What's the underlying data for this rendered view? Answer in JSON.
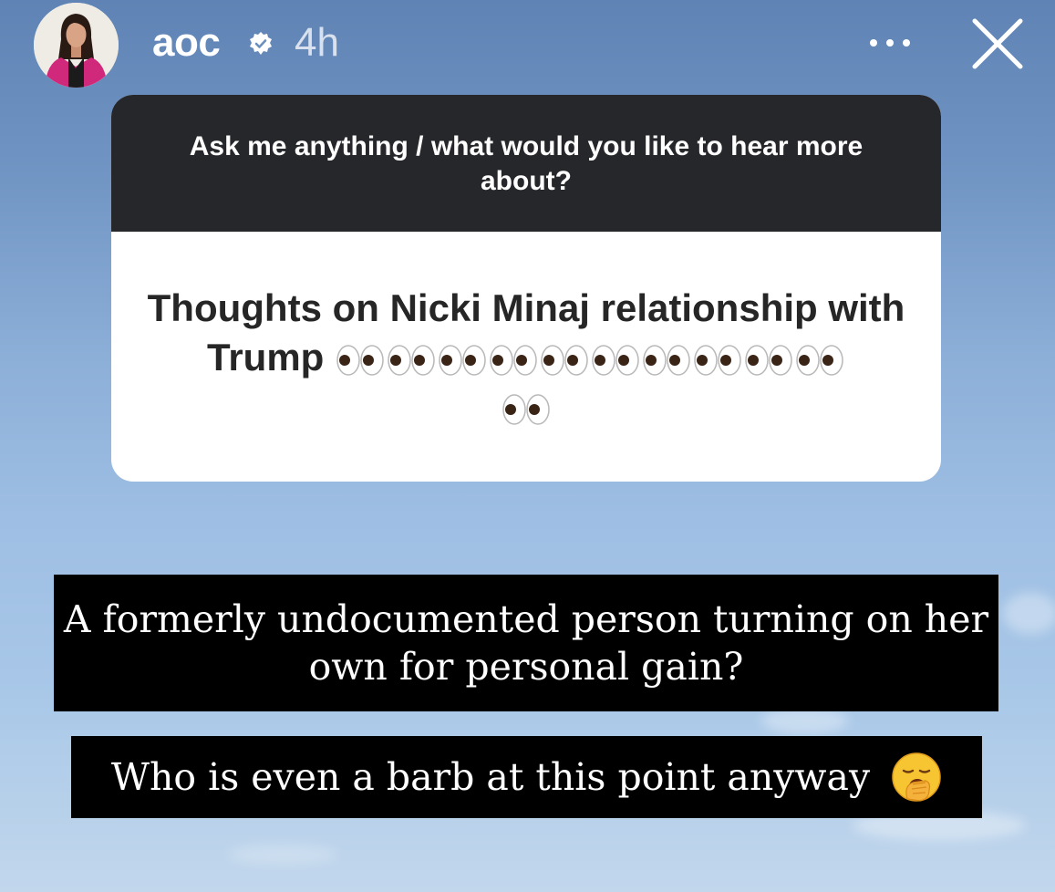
{
  "header": {
    "username": "aoc",
    "verified": true,
    "timestamp": "4h",
    "more_icon": "more-horizontal-icon",
    "close_icon": "close-icon"
  },
  "question_sticker": {
    "prompt": "Ask me anything / what would you like to hear more about?",
    "answer_text": "Thoughts on Nicki Minaj relationship with Trump",
    "answer_emoji": "eyes",
    "answer_emoji_count": 11
  },
  "captions": [
    {
      "text": "A formerly undocumented person turning on her own for personal gain?"
    },
    {
      "text": "Who is even a barb at this point anyway",
      "emoji": "yawning-face"
    }
  ],
  "colors": {
    "question_header_bg": "#26272b",
    "caption_bg": "#000000",
    "sky_top": "#5f83b4",
    "sky_bottom": "#c2d7ec"
  }
}
